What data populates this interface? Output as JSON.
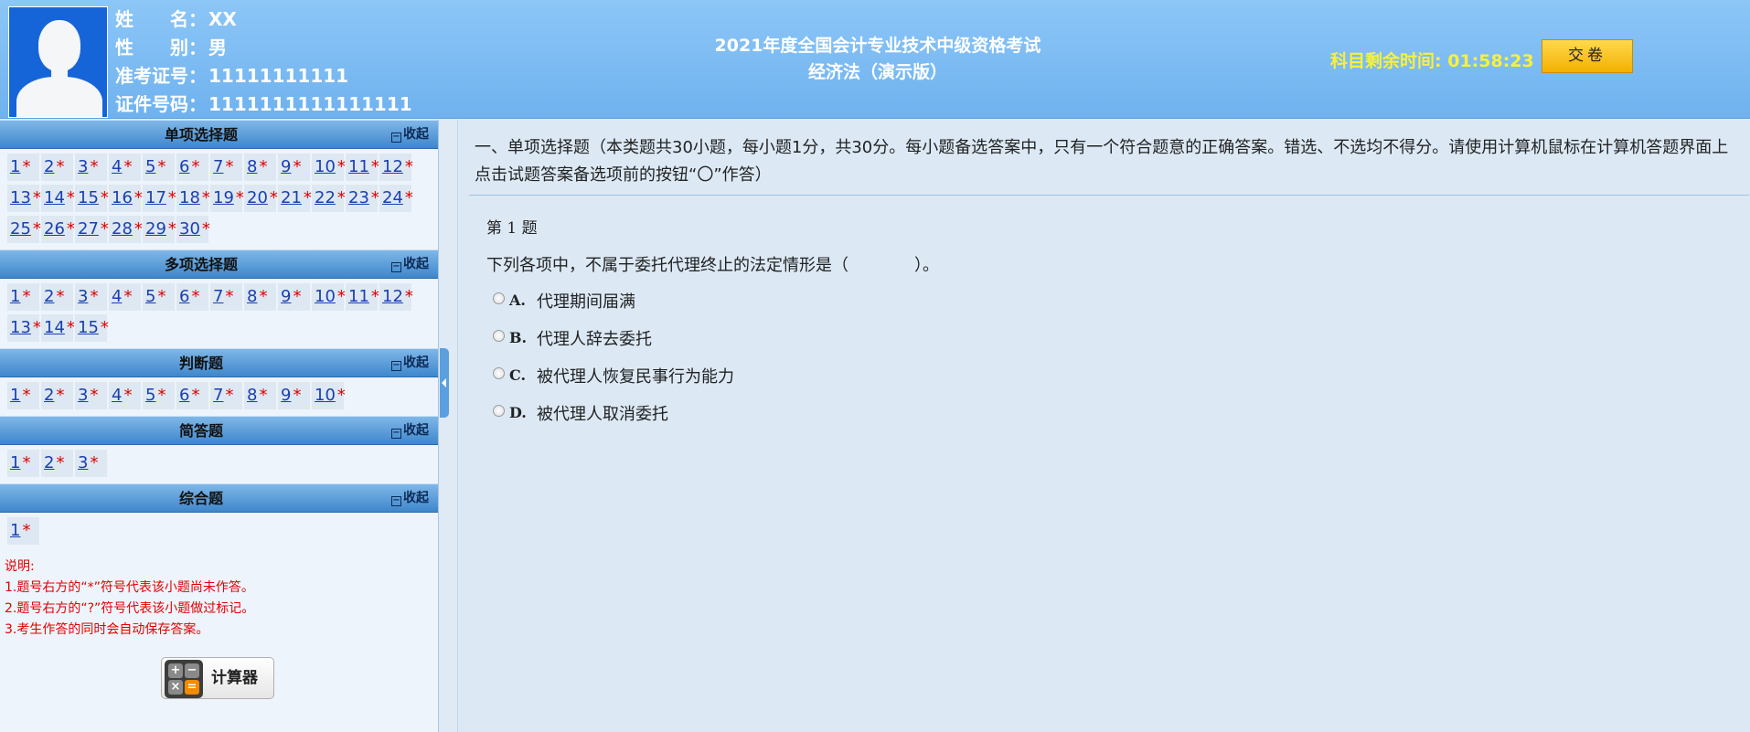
{
  "candidate": {
    "name_label": "姓　　名：",
    "name": "XX",
    "gender_label": "性　　别：",
    "gender": "男",
    "ticket_label": "准考证号：",
    "ticket": "11111111111",
    "id_label": "证件号码：",
    "id": "1111111111111111"
  },
  "exam": {
    "title_line1": "2021年度全国会计专业技术中级资格考试",
    "title_line2": "经济法（演示版）",
    "timer_label": "科目剩余时间:",
    "timer_value": "01:58:23",
    "submit_label": "交卷"
  },
  "sections": [
    {
      "title": "单项选择题",
      "collapse": "收起",
      "items": [
        "1",
        "2",
        "3",
        "4",
        "5",
        "6",
        "7",
        "8",
        "9",
        "10",
        "11",
        "12",
        "13",
        "14",
        "15",
        "16",
        "17",
        "18",
        "19",
        "20",
        "21",
        "22",
        "23",
        "24",
        "25",
        "26",
        "27",
        "28",
        "29",
        "30"
      ]
    },
    {
      "title": "多项选择题",
      "collapse": "收起",
      "items": [
        "1",
        "2",
        "3",
        "4",
        "5",
        "6",
        "7",
        "8",
        "9",
        "10",
        "11",
        "12",
        "13",
        "14",
        "15"
      ]
    },
    {
      "title": "判断题",
      "collapse": "收起",
      "items": [
        "1",
        "2",
        "3",
        "4",
        "5",
        "6",
        "7",
        "8",
        "9",
        "10"
      ]
    },
    {
      "title": "简答题",
      "collapse": "收起",
      "items": [
        "1",
        "2",
        "3"
      ]
    },
    {
      "title": "综合题",
      "collapse": "收起",
      "items": [
        "1"
      ]
    }
  ],
  "unanswered_mark": "*",
  "notes": [
    "说明:",
    "1.题号右方的“*”符号代表该小题尚未作答。",
    "2.题号右方的“?”符号代表该小题做过标记。",
    "3.考生作答的同时会自动保存答案。"
  ],
  "calculator_label": "计算器",
  "question": {
    "instruction": "一、单项选择题（本类题共30小题，每小题1分，共30分。每小题备选答案中，只有一个符合题意的正确答案。错选、不选均不得分。请使用计算机鼠标在计算机答题界面上点击试题答案备选项前的按钮“〇”作答）",
    "number": "第 1 题",
    "stem": "下列各项中，不属于委托代理终止的法定情形是（　　　　）。",
    "options": [
      {
        "letter": "A.",
        "text": "代理期间届满"
      },
      {
        "letter": "B.",
        "text": "代理人辞去委托"
      },
      {
        "letter": "C.",
        "text": "被代理人恢复民事行为能力"
      },
      {
        "letter": "D.",
        "text": "被代理人取消委托"
      }
    ]
  }
}
